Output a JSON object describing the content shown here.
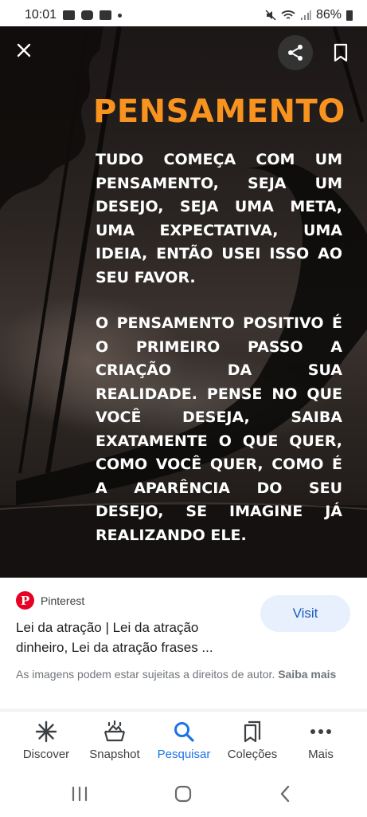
{
  "status_bar": {
    "time": "10:01",
    "battery_percent": "86%",
    "icons": [
      "gmail-icon",
      "photos-icon",
      "youtube-icon",
      "mute-icon",
      "wifi-icon",
      "signal-icon",
      "battery-icon"
    ]
  },
  "viewer": {
    "icons": {
      "close": "close-icon",
      "share": "share-icon",
      "save": "bookmark-icon"
    },
    "image_text": {
      "title": "PENSAMENTO",
      "paragraph1": "TUDO COMEÇA COM UM PENSAMENTO, SEJA UM DESEJO, SEJA UMA META, UMA EXPECTATIVA, UMA IDEIA, ENTÃO USEI ISSO AO SEU FAVOR.",
      "paragraph2": "O PENSAMENTO POSITIVO É O PRIMEIRO PASSO A CRIAÇÃO DA SUA REALIDADE. PENSE NO QUE VOCÊ DESEJA, SAIBA EXATAMENTE O QUE QUER, COMO VOCÊ QUER, COMO É A APARÊNCIA DO SEU DESEJO, SE IMAGINE JÁ REALIZANDO ELE."
    },
    "colors": {
      "title": "#f7931e",
      "text": "#ffffff"
    }
  },
  "result": {
    "source_name": "Pinterest",
    "source_icon": "pinterest-logo-icon",
    "title": "Lei da atração | Lei da atração dinheiro, Lei da atração frases ...",
    "visit_label": "Visit",
    "copyright_text": "As imagens podem estar sujeitas a direitos de autor.",
    "learn_more_label": "Saiba mais"
  },
  "bottom_nav": {
    "items": [
      {
        "label": "Discover",
        "icon": "asterisk-icon"
      },
      {
        "label": "Snapshot",
        "icon": "snapshot-icon"
      },
      {
        "label": "Pesquisar",
        "icon": "search-icon",
        "active": true
      },
      {
        "label": "Coleções",
        "icon": "collections-icon"
      },
      {
        "label": "Mais",
        "icon": "more-icon"
      }
    ],
    "active_color": "#1a73e8"
  },
  "system_nav": {
    "icons": [
      "recent-apps-icon",
      "home-icon",
      "back-icon"
    ]
  }
}
